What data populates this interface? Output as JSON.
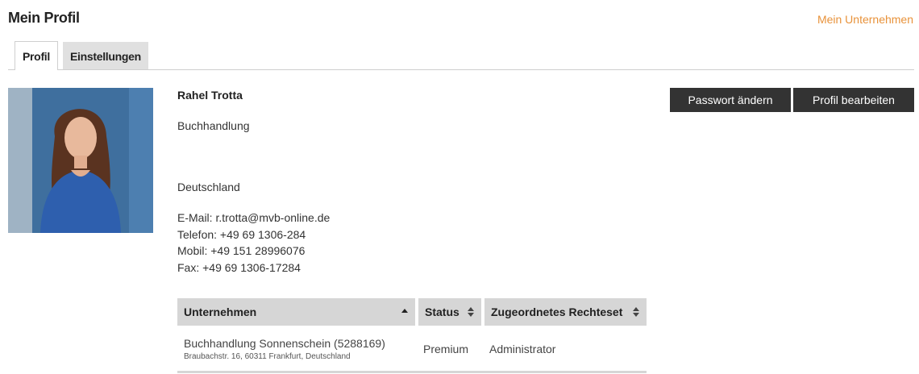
{
  "header": {
    "title": "Mein Profil",
    "company_link": "Mein Unternehmen"
  },
  "tabs": [
    {
      "label": "Profil",
      "active": true
    },
    {
      "label": "Einstellungen",
      "active": false
    }
  ],
  "profile": {
    "name": "Rahel Trotta",
    "organization": "Buchhandlung",
    "country": "Deutschland",
    "email_line": "E-Mail: r.trotta@mvb-online.de",
    "phone_line": "Telefon: +49 69 1306-284",
    "mobile_line": "Mobil: +49 151 28996076",
    "fax_line": "Fax: +49 69 1306-17284"
  },
  "actions": {
    "change_password": "Passwort ändern",
    "edit_profile": "Profil bearbeiten"
  },
  "companies_table": {
    "columns": [
      {
        "label": "Unternehmen",
        "sort": "asc"
      },
      {
        "label": "Status",
        "sort": "both"
      },
      {
        "label": "Zugeordnetes Rechteset",
        "sort": "both"
      }
    ],
    "rows": [
      {
        "company": "Buchhandlung Sonnenschein (5288169)",
        "address": "Braubachstr. 16, 60311 Frankfurt, Deutschland",
        "status": "Premium",
        "rights": "Administrator"
      }
    ]
  },
  "colors": {
    "accent": "#e8923a",
    "button_bg": "#333333",
    "table_header_bg": "#d6d6d6"
  },
  "icons": {
    "sort_asc": "caret-up-icon",
    "sort_both": "sort-icon"
  }
}
